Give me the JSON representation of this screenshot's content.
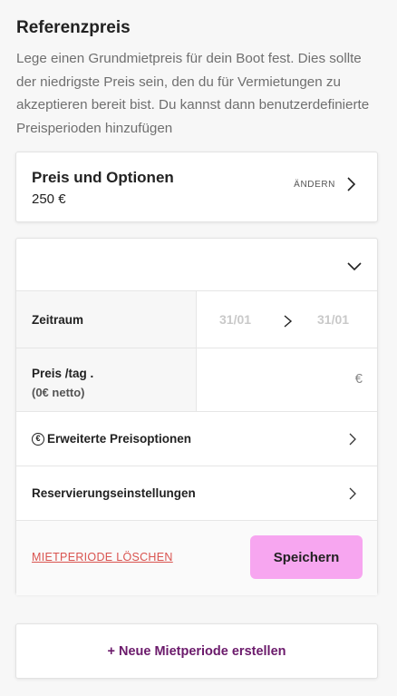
{
  "reference_price": {
    "heading": "Referenzpreis",
    "intro": "Lege einen Grundmietpreis für dein Boot fest. Dies sollte der niedrigste Preis sein, den du für Vermietungen zu akzeptieren bereit bist. Du kannst dann benutzerdefinierte Preisperioden hinzufügen"
  },
  "price_card": {
    "title": "Preis und Optionen",
    "value": "250 €",
    "change_label": "ÄNDERN"
  },
  "period_card": {
    "period": {
      "label": "Zeitraum",
      "start_date": "31/01",
      "end_date": "31/01"
    },
    "price": {
      "label": "Preis /tag .",
      "net_note": "(0€ netto)",
      "currency": "€",
      "value": ""
    },
    "extended_options": {
      "icon_glyph": "€",
      "label": "Erweiterte Preisoptionen"
    },
    "reservation_settings": {
      "label": "Reservierungseinstellungen"
    },
    "delete_label": "MIETPERIODE LÖSCHEN",
    "save_label": "Speichern"
  },
  "new_period": {
    "label": "+ Neue Mietperiode erstellen"
  },
  "colors": {
    "accent_button": "#f7a6f0",
    "delete_link": "#d9534f",
    "new_period_text": "#6b1a6b",
    "date_placeholder": "#c9c9c9"
  },
  "icons": {
    "chevron_right": "chevron-right-icon",
    "chevron_down": "chevron-down-icon",
    "euro_circle": "euro-circle-icon"
  }
}
